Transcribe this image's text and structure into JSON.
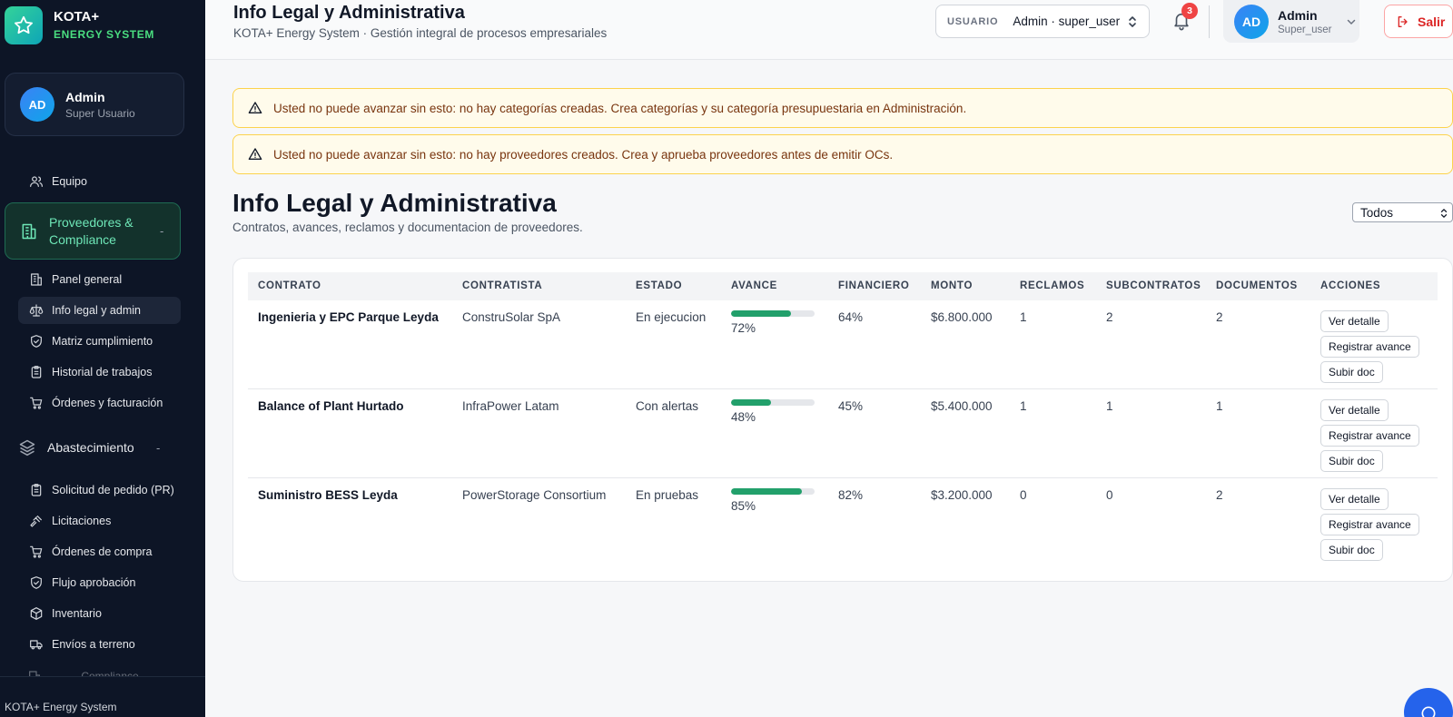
{
  "brand": {
    "name": "KOTA+",
    "subtitle": "ENERGY SYSTEM"
  },
  "sidebar": {
    "user": {
      "initials": "AD",
      "name": "Admin",
      "role": "Super Usuario"
    },
    "team_label": "Equipo",
    "group_compliance": {
      "label": "Proveedores & Compliance",
      "toggle": "-",
      "items": [
        {
          "label": "Panel general",
          "icon": "building-icon"
        },
        {
          "label": "Info legal y admin",
          "icon": "scale-icon",
          "active": true
        },
        {
          "label": "Matriz cumplimiento",
          "icon": "shield-check-icon"
        },
        {
          "label": "Historial de trabajos",
          "icon": "clipboard-icon"
        },
        {
          "label": "Órdenes y facturación",
          "icon": "cart-icon"
        }
      ]
    },
    "group_supply": {
      "label": "Abastecimiento",
      "toggle": "-",
      "items": [
        {
          "label": "Solicitud de pedido (PR)",
          "icon": "clipboard-icon"
        },
        {
          "label": "Licitaciones",
          "icon": "gavel-icon"
        },
        {
          "label": "Órdenes de compra",
          "icon": "cart-icon"
        },
        {
          "label": "Flujo aprobación",
          "icon": "shield-check-icon"
        },
        {
          "label": "Inventario",
          "icon": "box-icon"
        },
        {
          "label": "Envíos a terreno",
          "icon": "truck-icon"
        }
      ]
    },
    "faded_item": "Compliance proveedores",
    "footer": "KOTA+ Energy System"
  },
  "header": {
    "title": "Info Legal y Administrativa",
    "subtitle": "KOTA+ Energy System · Gestión integral de procesos empresariales",
    "user_select_label": "USUARIO",
    "user_select_value": "Admin · super_user",
    "notifications": "3",
    "user": {
      "initials": "AD",
      "name": "Admin",
      "role": "Super_user"
    },
    "logout": "Salir"
  },
  "alerts": [
    "Usted no puede avanzar sin esto: no hay categorías creadas. Crea categorías y su categoría presupuestaria en Administración.",
    "Usted no puede avanzar sin esto: no hay proveedores creados. Crea y aprueba proveedores antes de emitir OCs."
  ],
  "page": {
    "title": "Info Legal y Administrativa",
    "subtitle": "Contratos, avances, reclamos y documentacion de proveedores.",
    "filter_value": "Todos"
  },
  "table": {
    "columns": [
      "CONTRATO",
      "CONTRATISTA",
      "ESTADO",
      "AVANCE",
      "FINANCIERO",
      "MONTO",
      "RECLAMOS",
      "SUBCONTRATOS",
      "DOCUMENTOS",
      "ACCIONES"
    ],
    "actions": [
      "Ver detalle",
      "Registrar avance",
      "Subir doc"
    ],
    "rows": [
      {
        "contrato": "Ingenieria y EPC Parque Leyda",
        "contratista": "ConstruSolar SpA",
        "estado": "En ejecucion",
        "avance": 72,
        "avance_label": "72%",
        "financiero": "64%",
        "monto": "$6.800.000",
        "reclamos": "1",
        "subcontratos": "2",
        "documentos": "2"
      },
      {
        "contrato": "Balance of Plant Hurtado",
        "contratista": "InfraPower Latam",
        "estado": "Con alertas",
        "avance": 48,
        "avance_label": "48%",
        "financiero": "45%",
        "monto": "$5.400.000",
        "reclamos": "1",
        "subcontratos": "1",
        "documentos": "1"
      },
      {
        "contrato": "Suministro BESS Leyda",
        "contratista": "PowerStorage Consortium",
        "estado": "En pruebas",
        "avance": 85,
        "avance_label": "85%",
        "financiero": "82%",
        "monto": "$3.200.000",
        "reclamos": "0",
        "subcontratos": "0",
        "documentos": "2"
      }
    ]
  },
  "colors": {
    "accent": "#22a06b",
    "sidebar_bg": "#0d1526",
    "danger": "#dc2626",
    "warning_bg": "#fffbeb"
  }
}
